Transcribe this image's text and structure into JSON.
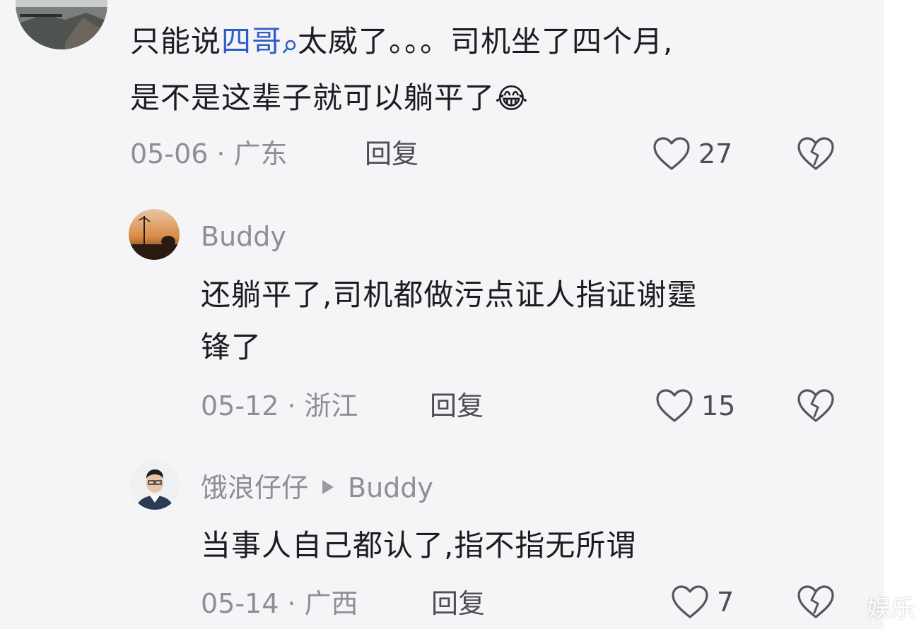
{
  "comments": [
    {
      "text_line1_pre": "只能说",
      "text_keyword": "四哥",
      "text_line1_post": "太威了。。。司机坐了四个月,",
      "text_line2": "是不是这辈子就可以躺平了",
      "emoji": "😂",
      "date": "05-06",
      "region": "广东",
      "reply_label": "回复",
      "likes": "27"
    },
    {
      "username": "Buddy",
      "text_line1": "还躺平了,司机都做污点证人指证谢霆",
      "text_line2": "锋了",
      "date": "05-12",
      "region": "浙江",
      "reply_label": "回复",
      "likes": "15"
    },
    {
      "username": "饿浪仔仔",
      "reply_to": "Buddy",
      "text_line1": "当事人自己都认了,指不指无所谓",
      "date": "05-14",
      "region": "广西",
      "reply_label": "回复",
      "likes": "7"
    }
  ],
  "meta_separator": "·",
  "watermark": "娱乐",
  "icons": {
    "like": "heart-outline-icon",
    "dislike": "broken-heart-icon",
    "search": "search-mini-icon"
  },
  "colors": {
    "background": "#f5f5f7",
    "keyword": "#2e5cc6",
    "text": "#1d1d21",
    "meta": "#8e8e95"
  }
}
